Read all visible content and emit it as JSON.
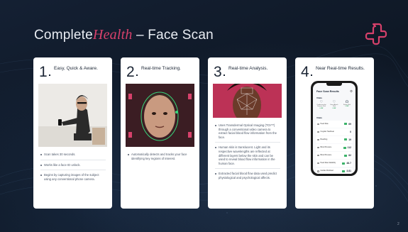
{
  "header": {
    "title_prefix": "Complete",
    "title_accent": "Health",
    "title_suffix": " – Face Scan"
  },
  "brand": {
    "accent_color": "#d7416b",
    "background_color": "#0f1826"
  },
  "cards": [
    {
      "number": "1",
      "title": "Easy, Quick & Aware.",
      "image_icon": "person-with-phone-photo",
      "bullets": [
        "Scan takes 30 seconds.",
        "Works like a face ID unlock.",
        "Begins by capturing images of the subject using any conventional phone camera."
      ]
    },
    {
      "number": "2",
      "title": "Real-time Tracking.",
      "image_icon": "face-tracking-photo",
      "bullets": [
        "Automatically detects and tracks your face identifying key regions of interest."
      ]
    },
    {
      "number": "3",
      "title": "Real-time Analysis.",
      "image_icon": "face-mesh-analysis-photo",
      "bullets": [
        "Uses Transdermal Optical Imaging (TOI™) through a conventional video camera to extract facial blood flow information from the face.",
        "Human skin is translucent. Light and its respective wavelengths are reflected at different layers below the skin and can be used to reveal blood flow information in the human face.",
        "Extracted facial blood flow data used predict physiological and psychological affects."
      ]
    },
    {
      "number": "4",
      "title": "Near Real-time Results.",
      "phone": {
        "screen_title": "Face Scan Results",
        "vitals_label": "Vitals",
        "vitals_icons": [
          {
            "icon": "heart-icon",
            "label": "Cardiovascular Disease Risk",
            "value": "LOW"
          },
          {
            "icon": "heart-attack-icon",
            "label": "Heart Attack Risk",
            "value": "LOW"
          },
          {
            "icon": "stroke-icon",
            "label": "Stroke Risk",
            "value": "LOW"
          }
        ],
        "stats_label": "Vitals",
        "rows": [
          {
            "name": "Heart Rate",
            "value": "69"
          },
          {
            "name": "Irregular Heartbeat",
            "value": "0"
          },
          {
            "name": "Breathing",
            "value": "19"
          },
          {
            "name": "Blood Pressure",
            "value": "112"
          },
          {
            "name": "Blood Pressure",
            "value": "82"
          },
          {
            "name": "Heart Rate Variability",
            "value": "48.7"
          },
          {
            "name": "Cardiac Workload",
            "value": "3.81"
          }
        ]
      }
    }
  ],
  "page_number": "2"
}
